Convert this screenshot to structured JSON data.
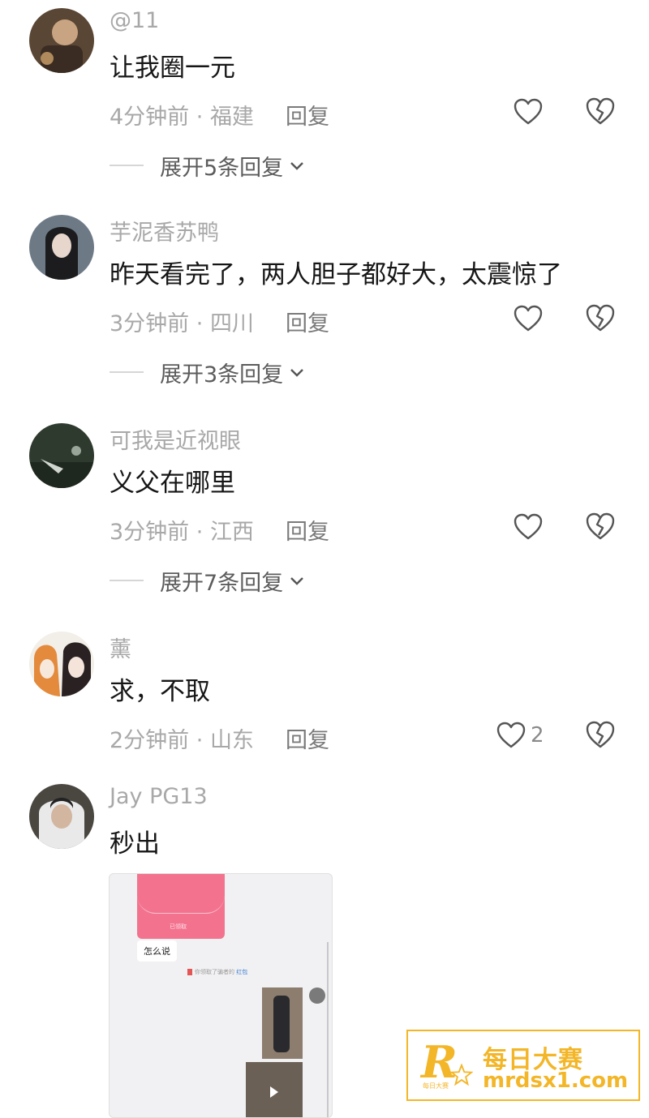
{
  "comments": [
    {
      "username": "@11",
      "content": "让我圈一元",
      "time": "4分钟前",
      "location": "福建",
      "reply_label": "回复",
      "expand_label": "展开5条回复",
      "likes": ""
    },
    {
      "username": "芋泥香苏鸭",
      "content": "昨天看完了，两人胆子都好大，太震惊了",
      "time": "3分钟前",
      "location": "四川",
      "reply_label": "回复",
      "expand_label": "展开3条回复",
      "likes": ""
    },
    {
      "username": "可我是近视眼",
      "content": "义父在哪里",
      "time": "3分钟前",
      "location": "江西",
      "reply_label": "回复",
      "expand_label": "展开7条回复",
      "likes": ""
    },
    {
      "username": "薰",
      "content": "求，不取",
      "time": "2分钟前",
      "location": "山东",
      "reply_label": "回复",
      "expand_label": "",
      "likes": "2"
    },
    {
      "username": "Jay  PG13",
      "content": "秒出",
      "time": "",
      "location": "",
      "reply_label": "",
      "expand_label": "",
      "likes": ""
    }
  ],
  "image_preview": {
    "bubble_text": "怎么说",
    "packet_label": "已领取",
    "notice_text": "你领取了骗者的",
    "notice_link": "红包"
  },
  "watermark": {
    "logo_letter": "R",
    "logo_small": "每日大赛",
    "name": "每日大赛",
    "url": "mrdsx1.com"
  },
  "colors": {
    "secondary_text": "#a8a8a8",
    "body_text": "#161616",
    "watermark": "#f3b628",
    "red_packet": "#f3738f"
  }
}
